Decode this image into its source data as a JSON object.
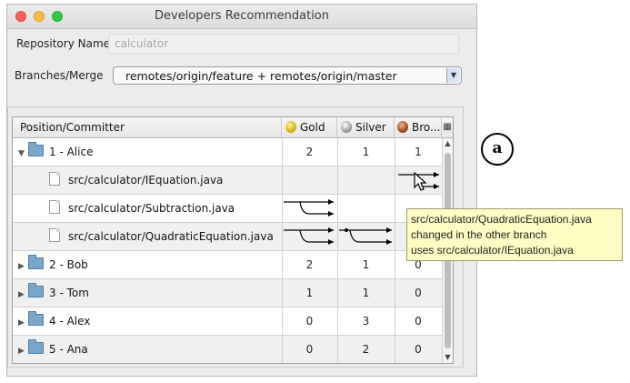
{
  "window": {
    "title": "Developers Recommendation"
  },
  "form": {
    "repo_label": "Repository Name",
    "repo_value": "calculator",
    "branches_label": "Branches/Merge",
    "branches_value": "remotes/origin/feature +   remotes/origin/master"
  },
  "table": {
    "headers": {
      "committer": "Position/Committer",
      "gold": "Gold",
      "silver": "Silver",
      "bronze": "Bro..."
    },
    "rows": [
      {
        "name": "1 - Alice",
        "gold": "2",
        "silver": "1",
        "bronze": "1",
        "expanded": true
      },
      {
        "file": "src/calculator/IEquation.java"
      },
      {
        "file": "src/calculator/Subtraction.java"
      },
      {
        "file": "src/calculator/QuadraticEquation.java"
      },
      {
        "name": "2 - Bob",
        "gold": "2",
        "silver": "1",
        "bronze": "0"
      },
      {
        "name": "3 - Tom",
        "gold": "1",
        "silver": "1",
        "bronze": "0"
      },
      {
        "name": "4 - Alex",
        "gold": "0",
        "silver": "3",
        "bronze": "0"
      },
      {
        "name": "5 - Ana",
        "gold": "0",
        "silver": "2",
        "bronze": "0"
      }
    ]
  },
  "tooltip": {
    "line1": "src/calculator/QuadraticEquation.java",
    "line2": "changed in the other branch",
    "line3": "uses src/calculator/IEquation.java"
  },
  "annotation": "a",
  "icons": {
    "expand": "triangle-down-icon",
    "collapse": "triangle-right-icon",
    "folder": "folder-icon",
    "file": "file-icon",
    "gold": "gold-medal-icon",
    "silver": "silver-medal-icon",
    "bronze": "bronze-medal-icon"
  },
  "colors": {
    "tooltip_bg": "#fdfdc3",
    "folder": "#7aa6c9"
  }
}
